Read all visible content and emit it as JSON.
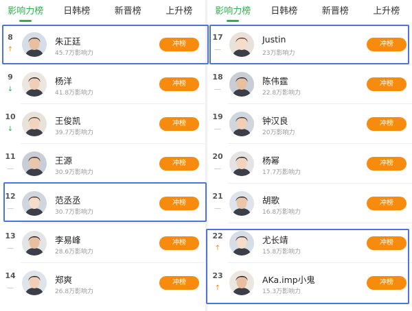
{
  "colors": {
    "accent_green": "#2cb24a",
    "button_orange": "#f78b0e",
    "highlight_blue": "#4a72e0"
  },
  "tabs": [
    "影响力榜",
    "日韩榜",
    "新晋榜",
    "上升榜"
  ],
  "active_tab": 0,
  "button_label": "冲榜",
  "left_list": [
    {
      "rank": "8",
      "trend": "up",
      "name": "朱正廷",
      "influence": "45.7万影响力"
    },
    {
      "rank": "9",
      "trend": "down",
      "name": "杨洋",
      "influence": "41.8万影响力"
    },
    {
      "rank": "10",
      "trend": "down",
      "name": "王俊凯",
      "influence": "39.7万影响力"
    },
    {
      "rank": "11",
      "trend": "flat",
      "name": "王源",
      "influence": "30.9万影响力"
    },
    {
      "rank": "12",
      "trend": "flat",
      "name": "范丞丞",
      "influence": "30.7万影响力"
    },
    {
      "rank": "13",
      "trend": "flat",
      "name": "李易峰",
      "influence": "28.6万影响力"
    },
    {
      "rank": "14",
      "trend": "flat",
      "name": "郑爽",
      "influence": "26.8万影响力"
    }
  ],
  "right_list": [
    {
      "rank": "17",
      "trend": "flat",
      "name": "Justin",
      "influence": "23万影响力"
    },
    {
      "rank": "18",
      "trend": "flat",
      "name": "陈伟霆",
      "influence": "22.8万影响力"
    },
    {
      "rank": "19",
      "trend": "flat",
      "name": "钟汉良",
      "influence": "20万影响力"
    },
    {
      "rank": "20",
      "trend": "flat",
      "name": "杨幂",
      "influence": "17.7万影响力"
    },
    {
      "rank": "21",
      "trend": "flat",
      "name": "胡歌",
      "influence": "16.8万影响力"
    },
    {
      "rank": "22",
      "trend": "up",
      "name": "尤长靖",
      "influence": "15.8万影响力"
    },
    {
      "rank": "23",
      "trend": "up",
      "name": "AKa.imp小鬼",
      "influence": "15.3万影响力"
    }
  ]
}
